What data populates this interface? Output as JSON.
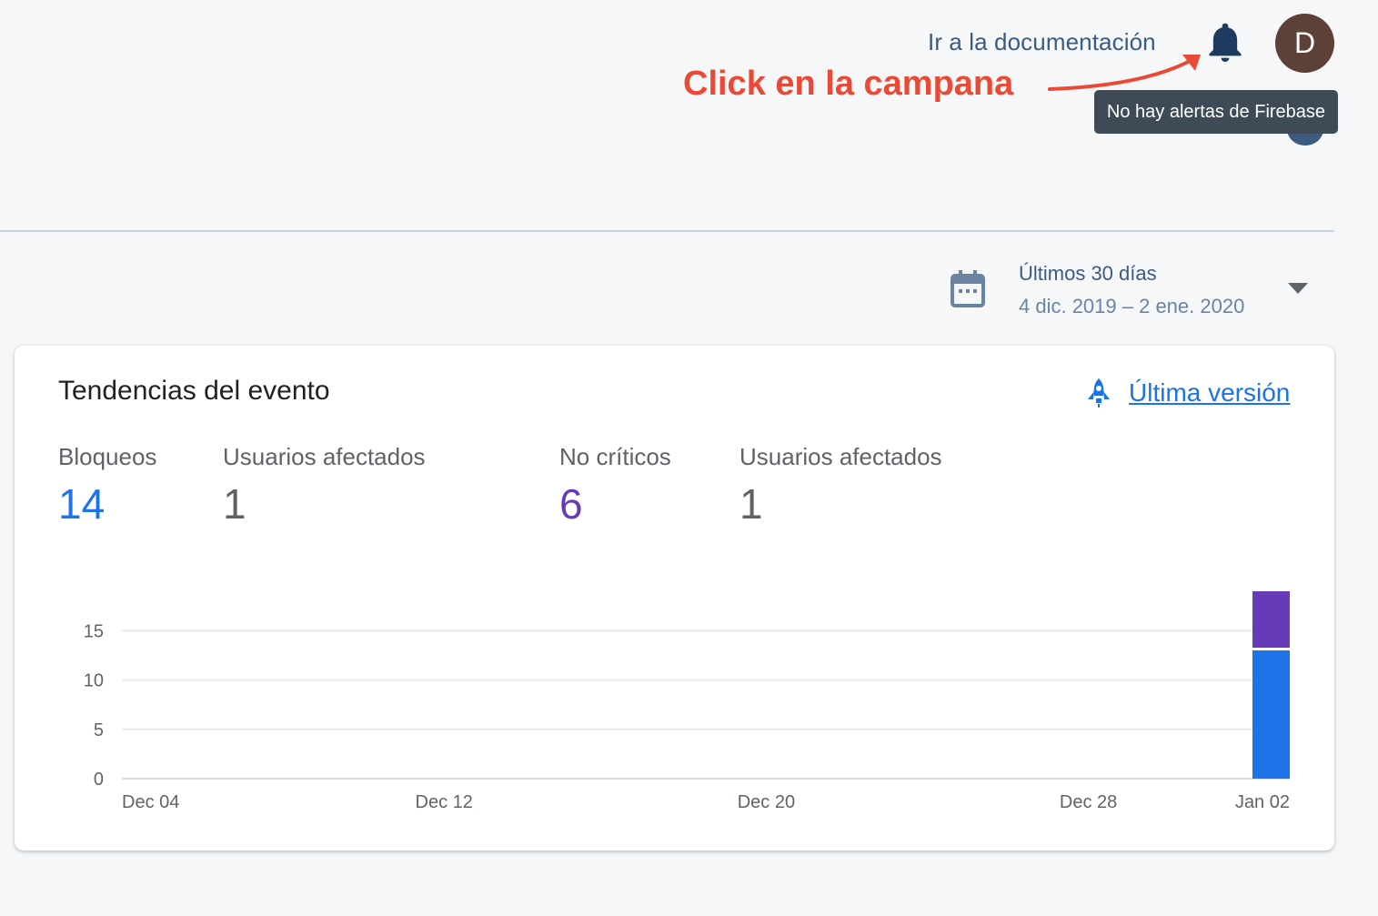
{
  "header": {
    "doc_link": "Ir a la documentación",
    "avatar_letter": "D",
    "tooltip": "No hay alertas de Firebase",
    "annotation": "Click en la campana"
  },
  "date_range": {
    "title": "Últimos 30 días",
    "range": "4 dic. 2019 – 2 ene. 2020"
  },
  "card": {
    "title": "Tendencias del evento",
    "latest_version_label": "Última versión",
    "stats": [
      {
        "label": "Bloqueos",
        "value": "14"
      },
      {
        "label": "Usuarios afectados",
        "value": "1"
      },
      {
        "label": "No críticos",
        "value": "6"
      },
      {
        "label": "Usuarios afectados",
        "value": "1"
      }
    ]
  },
  "colors": {
    "crashes": "#1f73e8",
    "non_fatal": "#673ab7",
    "annotation": "#e94a35",
    "avatar": "#5d4037"
  },
  "chart_data": {
    "type": "bar",
    "stacked": true,
    "y_ticks": [
      "0",
      "5",
      "10",
      "15"
    ],
    "ylim": [
      0,
      19
    ],
    "x_start": "2019-12-04",
    "x_end": "2020-01-02",
    "x_ticks": [
      {
        "label": "Dec 04",
        "date": "2019-12-04"
      },
      {
        "label": "Dec 12",
        "date": "2019-12-12"
      },
      {
        "label": "Dec 20",
        "date": "2019-12-20"
      },
      {
        "label": "Dec 28",
        "date": "2019-12-28"
      },
      {
        "label": "Jan 02",
        "date": "2020-01-02"
      }
    ],
    "series": [
      {
        "key": "crashes",
        "points": [
          {
            "date": "2020-01-02",
            "value": 13
          }
        ]
      },
      {
        "key": "non_fatal",
        "points": [
          {
            "date": "2020-01-02",
            "value": 6
          }
        ]
      }
    ],
    "grid": true
  }
}
